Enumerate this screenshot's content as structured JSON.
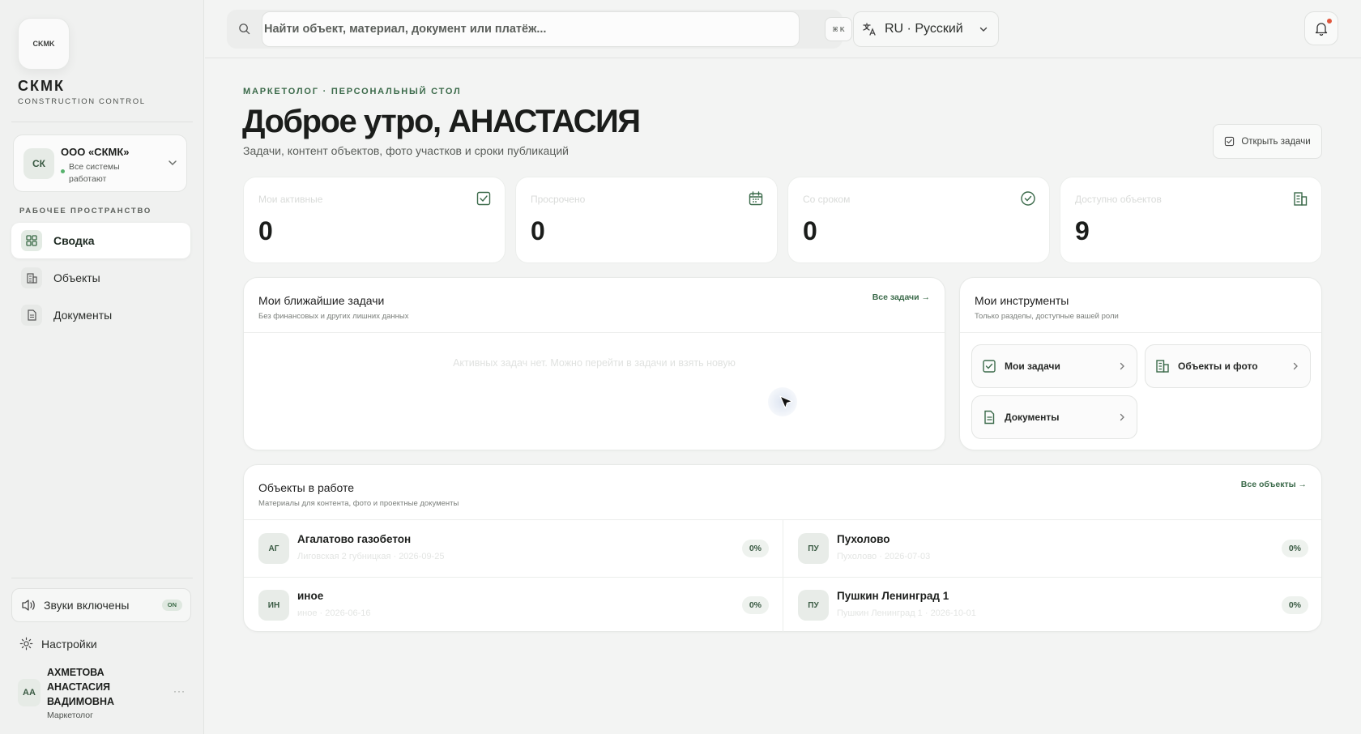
{
  "brand": {
    "logo_text": "CKMK",
    "name": "СКМК",
    "subtitle": "CONSTRUCTION CONTROL"
  },
  "org": {
    "initials": "СК",
    "name": "ООО «СКМК»",
    "status": "Все системы работают"
  },
  "sidebar": {
    "section_label": "РАБОЧЕЕ ПРОСТРАНСТВО",
    "items": [
      {
        "label": "Сводка",
        "icon": "dashboard-icon",
        "active": true
      },
      {
        "label": "Объекты",
        "icon": "building-icon",
        "active": false
      },
      {
        "label": "Документы",
        "icon": "document-icon",
        "active": false
      }
    ],
    "sound_label": "Звуки включены",
    "sound_badge": "ON",
    "settings_label": "Настройки"
  },
  "user": {
    "initials": "АА",
    "name": "АХМЕТОВА АНАСТАСИЯ ВАДИМОВНА",
    "role": "Маркетолог",
    "more": "···"
  },
  "topbar": {
    "search_placeholder": "Найти объект, материал, документ или платёж...",
    "shortcut": "⌘ K",
    "language": "RU · Русский"
  },
  "header": {
    "eyebrow": "МАРКЕТОЛОГ · ПЕРСОНАЛЬНЫЙ СТОЛ",
    "greeting": "Доброе утро, АНАСТАСИЯ",
    "subtitle": "Задачи, контент объектов, фото участков и сроки публикаций",
    "open_tasks_label": "Открыть задачи"
  },
  "stats": [
    {
      "label": "Мои активные",
      "value": "0",
      "icon": "check-square-icon"
    },
    {
      "label": "Просрочено",
      "value": "0",
      "icon": "calendar-icon"
    },
    {
      "label": "Со сроком",
      "value": "0",
      "icon": "check-circle-icon"
    },
    {
      "label": "Доступно объектов",
      "value": "9",
      "icon": "building-icon"
    }
  ],
  "tasks_panel": {
    "title": "Мои ближайшие задачи",
    "subtitle": "Без финансовых и других лишних данных",
    "link": "Все задачи →",
    "empty": "Активных задач нет. Можно перейти в задачи и взять новую"
  },
  "tools_panel": {
    "title": "Мои инструменты",
    "subtitle": "Только разделы, доступные вашей роли",
    "tools": [
      {
        "label": "Мои задачи",
        "icon": "check-square-icon"
      },
      {
        "label": "Объекты и фото",
        "icon": "building-icon"
      },
      {
        "label": "Документы",
        "icon": "document-icon"
      }
    ]
  },
  "objects_panel": {
    "title": "Объекты в работе",
    "subtitle": "Материалы для контента, фото и проектные документы",
    "link": "Все объекты →",
    "objects": [
      {
        "initials": "АГ",
        "name": "Агалатово газобетон",
        "meta": "Лиговская 2 губницкая · 2026-09-25",
        "progress": "0%"
      },
      {
        "initials": "ПУ",
        "name": "Пухолово",
        "meta": "Пухолово · 2026-07-03",
        "progress": "0%"
      },
      {
        "initials": "ИН",
        "name": "иное",
        "meta": "иное · 2026-06-16",
        "progress": "0%"
      },
      {
        "initials": "ПУ",
        "name": "Пушкин Ленинград 1",
        "meta": "Пушкин Ленинград 1 · 2026-10-01",
        "progress": "0%"
      }
    ]
  },
  "colors": {
    "accent": "#3b6a4a",
    "notification_dot": "#e0563c",
    "status_ok": "#57b26d"
  }
}
